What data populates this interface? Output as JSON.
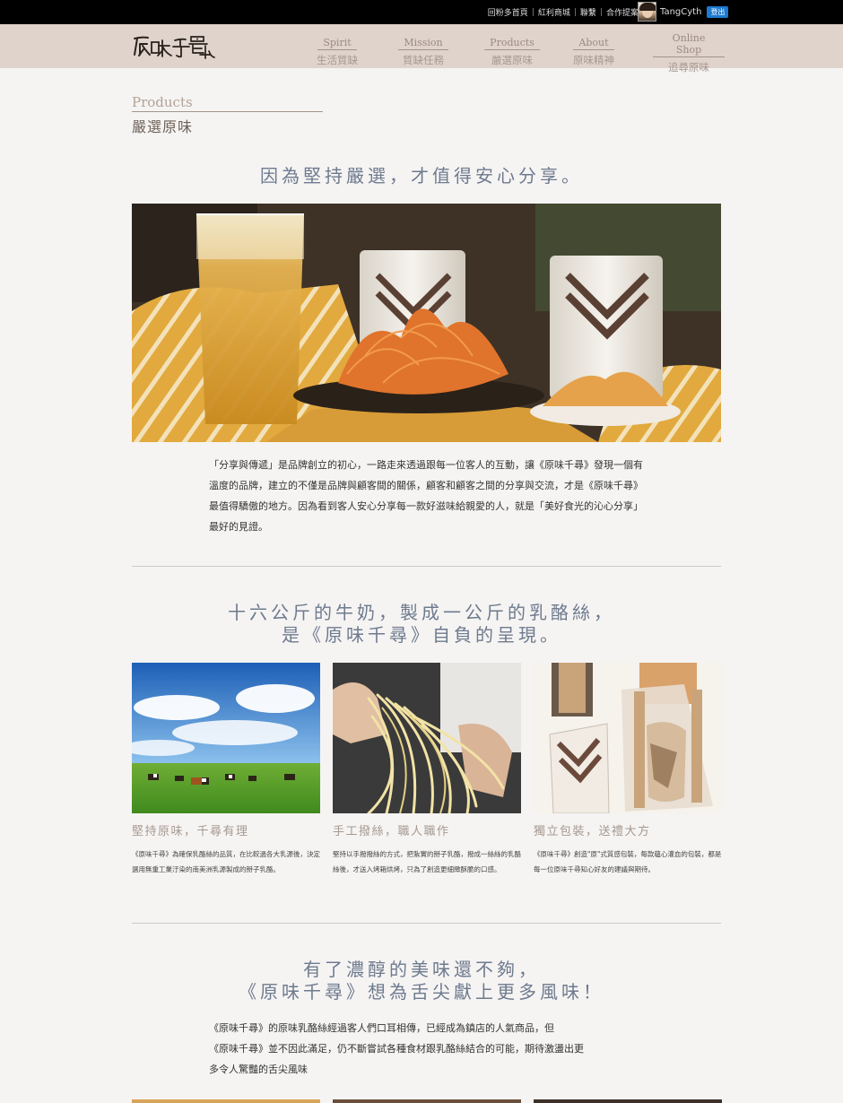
{
  "topbar": {
    "links": [
      "回粉多首頁",
      "紅利商城",
      "聯繫",
      "合作提案"
    ],
    "username": "TangCyth",
    "logout_label": "登出"
  },
  "nav": {
    "logo_text": "原味千尋",
    "items": [
      {
        "en": "Spirit",
        "zh": "生活質缺"
      },
      {
        "en": "Mission",
        "zh": "質缺任務"
      },
      {
        "en": "Products",
        "zh": "嚴選原味"
      },
      {
        "en": "About",
        "zh": "原味精神"
      },
      {
        "en": "Online Shop",
        "zh": "追尋原味"
      }
    ]
  },
  "section": {
    "en": "Products",
    "zh": "嚴選原味"
  },
  "block1": {
    "headline": "因為堅持嚴選，才值得安心分享。",
    "paragraph": "「分享與傳遞」是品牌創立的初心，一路走來透過跟每一位客人的互動，讓《原味千尋》發現一個有溫度的品牌，建立的不僅是品牌與顧客間的關係，顧客和顧客之間的分享與交流，才是《原味千尋》最值得驕傲的地方。因為看到客人安心分享每一款好滋味給親愛的人，就是「美好食光的沁心分享」最好的見證。"
  },
  "block2": {
    "headline_line1": "十六公斤的牛奶，製成一公斤的乳酪絲，",
    "headline_line2": "是《原味千尋》自負的呈現。",
    "features": [
      {
        "title": "堅持原味，千尋有理",
        "text": "《原味千尋》為確保乳酪絲的品質，在比較過各大乳源後，決定選用無重工業汙染的南美洲乳源製成的掰子乳酪。"
      },
      {
        "title": "手工撥絲，職人職作",
        "text": "堅持以手撥撥絲的方式，把紮實的掰子乳酪，撥成一絲絲的乳酪絲後，才送入烤箱烘烤，只為了創造更細緻酥脆的口感。"
      },
      {
        "title": "獨立包裝，送禮大方",
        "text": "《原味千尋》創造\"原\"式質感包裝，每款蘊心灌血的包裝，都是每一位原味千尋知心好友的建議與期待。"
      }
    ]
  },
  "block3": {
    "headline_line1": "有了濃醇的美味還不夠，",
    "headline_line2": "《原味千尋》想為舌尖獻上更多風味！",
    "para_line1": "《原味千尋》的原味乳酪絲經過客人們口耳相傳，已經成為鎮店的人氣商品，但",
    "para_line2": "《原味千尋》並不因此滿足，仍不斷嘗試各種食材跟乳酪絲結合的可能，期待激盪出更",
    "para_line3": "多令人驚豔的舌尖風味"
  }
}
